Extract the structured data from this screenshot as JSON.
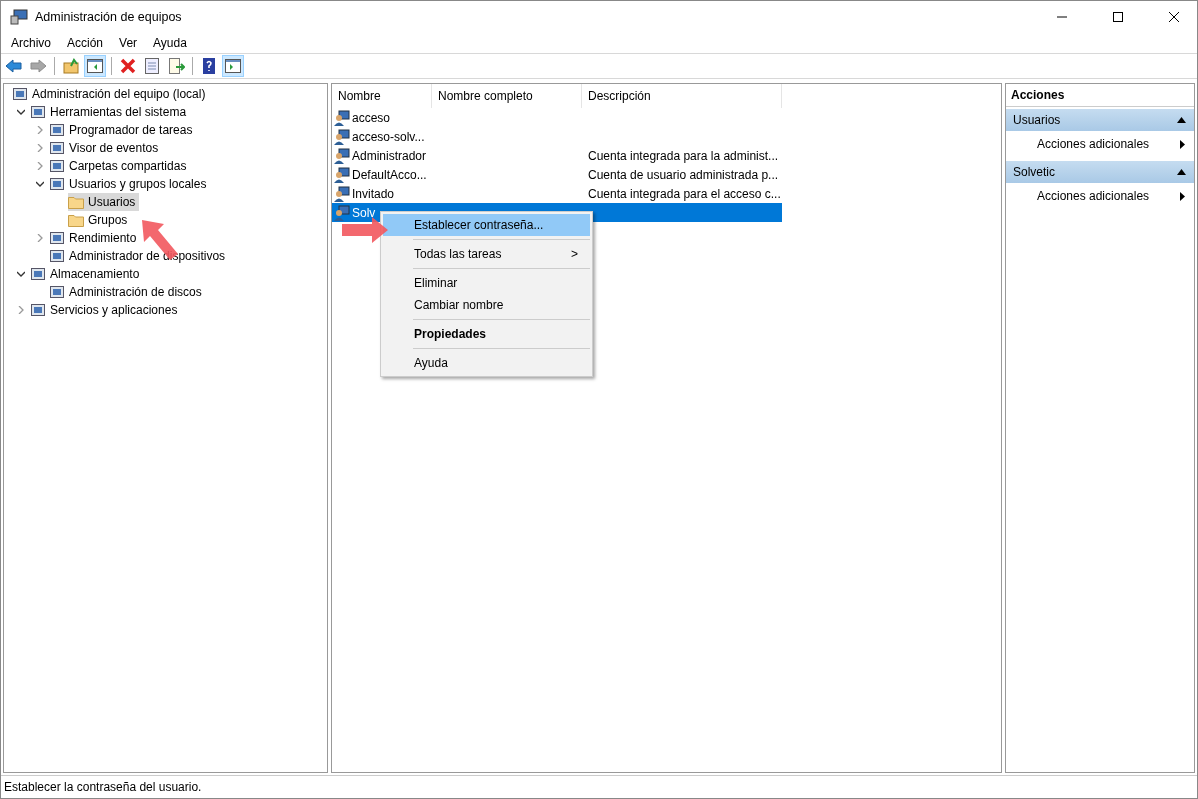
{
  "window": {
    "title": "Administración de equipos"
  },
  "menu": [
    "Archivo",
    "Acción",
    "Ver",
    "Ayuda"
  ],
  "toolbar": [
    {
      "kind": "back",
      "pressed": false,
      "disabled": false
    },
    {
      "kind": "forward",
      "pressed": false,
      "disabled": true
    },
    {
      "kind": "up",
      "pressed": false,
      "disabled": false
    },
    {
      "kind": "tree",
      "pressed": true,
      "disabled": false
    },
    {
      "kind": "delete",
      "pressed": false,
      "disabled": false
    },
    {
      "kind": "properties",
      "pressed": false,
      "disabled": false
    },
    {
      "kind": "export",
      "pressed": false,
      "disabled": false
    },
    {
      "kind": "help",
      "pressed": false,
      "disabled": false
    },
    {
      "kind": "actions",
      "pressed": true,
      "disabled": false
    }
  ],
  "tree": [
    {
      "label": "Administración del equipo (local)",
      "selected": false,
      "children": [
        {
          "label": "Herramientas del sistema",
          "selected": false,
          "expanded": true,
          "children": [
            {
              "label": "Programador de tareas",
              "selected": false,
              "expanded": false
            },
            {
              "label": "Visor de eventos",
              "selected": false,
              "expanded": false
            },
            {
              "label": "Carpetas compartidas",
              "selected": false,
              "expanded": false
            },
            {
              "label": "Usuarios y grupos locales",
              "selected": false,
              "expanded": true,
              "children": [
                {
                  "label": "Usuarios",
                  "selected": true
                },
                {
                  "label": "Grupos",
                  "selected": false
                }
              ]
            },
            {
              "label": "Rendimiento",
              "selected": false,
              "expanded": false
            },
            {
              "label": "Administrador de dispositivos",
              "selected": false
            }
          ]
        },
        {
          "label": "Almacenamiento",
          "selected": false,
          "expanded": true,
          "children": [
            {
              "label": "Administración de discos",
              "selected": false
            }
          ]
        },
        {
          "label": "Servicios y aplicaciones",
          "selected": false,
          "expanded": false
        }
      ]
    }
  ],
  "table": {
    "columns": [
      "Nombre",
      "Nombre completo",
      "Descripción"
    ],
    "rows": [
      {
        "name": "acceso",
        "description": "",
        "selected": false
      },
      {
        "name": "acceso-solv...",
        "description": "",
        "selected": false
      },
      {
        "name": "Administrador",
        "description": "Cuenta integrada para la administ...",
        "selected": false
      },
      {
        "name": "DefaultAcco...",
        "description": "Cuenta de usuario administrada p...",
        "selected": false
      },
      {
        "name": "Invitado",
        "description": "Cuenta integrada para el acceso c...",
        "selected": false
      },
      {
        "name": "Solv",
        "description": "",
        "selected": true
      }
    ]
  },
  "context_menu": [
    {
      "kind": "item",
      "label": "Establecer contraseña...",
      "selected": true
    },
    {
      "kind": "separator"
    },
    {
      "kind": "submenu",
      "label": "Todas las tareas",
      "arrow": ">",
      "selected": false
    },
    {
      "kind": "separator"
    },
    {
      "kind": "item",
      "label": "Eliminar",
      "selected": false
    },
    {
      "kind": "item",
      "label": "Cambiar nombre",
      "selected": false
    },
    {
      "kind": "separator"
    },
    {
      "kind": "default",
      "label": "Propiedades",
      "selected": false
    },
    {
      "kind": "separator"
    },
    {
      "kind": "item",
      "label": "Ayuda",
      "selected": false
    }
  ],
  "actions": {
    "title": "Acciones",
    "sections": [
      {
        "title": "Usuarios",
        "expanded": true,
        "items": [
          "Acciones adicionales"
        ]
      },
      {
        "title": "Solvetic",
        "expanded": true,
        "items": [
          "Acciones adicionales"
        ]
      }
    ]
  },
  "status_bar": "Establecer la contraseña del usuario."
}
